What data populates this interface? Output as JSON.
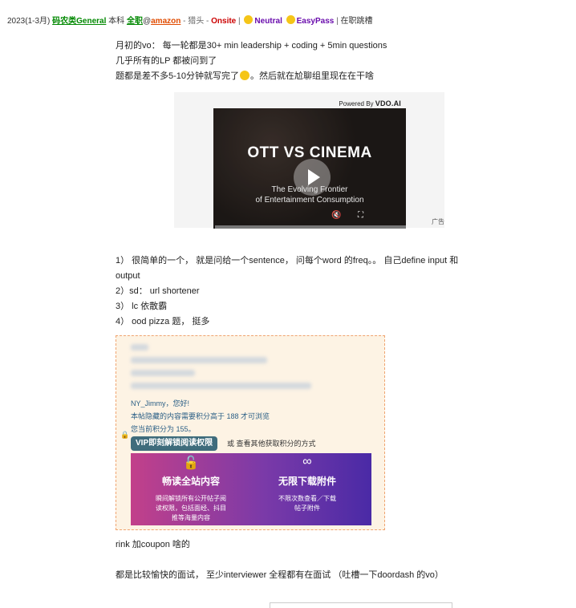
{
  "header": {
    "date": "2023(1-3月)",
    "category": "码农类General",
    "degree": "本科",
    "job_type": "全职",
    "at": "@",
    "company": "amazon",
    "sep1": " - ",
    "source": "猎头",
    "sep2": " - ",
    "interview_type": "Onsite",
    "sep3": " | ",
    "sentiment": "Neutral",
    "difficulty": "EasyPass",
    "sep4": " | ",
    "status": "在职跳槽"
  },
  "post": {
    "line1": "月初的vo： 每一轮都是30+ min leadership + coding + 5min questions",
    "line2": "几乎所有的LP 都被问到了",
    "line3_a": "题都是差不多5-10分钟就写完了",
    "line3_b": "。然后就在尬聊组里现在在干啥"
  },
  "ad": {
    "powered_by": "Powered By",
    "brand": "VDO.AI",
    "video_title": "OTT VS CINEMA",
    "video_sub1": "The Evolving Frontier",
    "video_sub2": "of Entertainment Consumption",
    "label": "广告"
  },
  "questions": {
    "q1a": "1） 很简单的一个， 就是问给一个sentence， 问每个word 的freq。。 自己define input 和",
    "q1b": "output",
    "q2": "2）sd： url shortener",
    "q3": "3） lc 依散霸",
    "q4": "4） ood pizza 题， 挺多"
  },
  "hidden": {
    "greeting": "NY_Jimmy，您好!",
    "req": "本帖隐藏的内容需要积分高于 188 才可浏览",
    "current": "您当前积分为 155。",
    "vip_button": "VIP即刻解锁阅读权限",
    "other": "或 查看其他获取积分的方式",
    "promo_left_title": "畅读全站内容",
    "promo_left_desc1": "瞬间解锁所有公开帖子阅",
    "promo_left_desc2": "读权限，包括面经、抖目",
    "promo_left_desc3": "推等海量内容",
    "promo_right_title": "无限下载附件",
    "promo_right_desc1": "不限次数查看／下载",
    "promo_right_desc2": "帖子附件"
  },
  "after": {
    "line1": "rink 加coupon 啥的",
    "line2": "都是比较愉快的面试， 至少interviewer 全程都有在面试 （吐槽一下doordash 的vo）"
  }
}
